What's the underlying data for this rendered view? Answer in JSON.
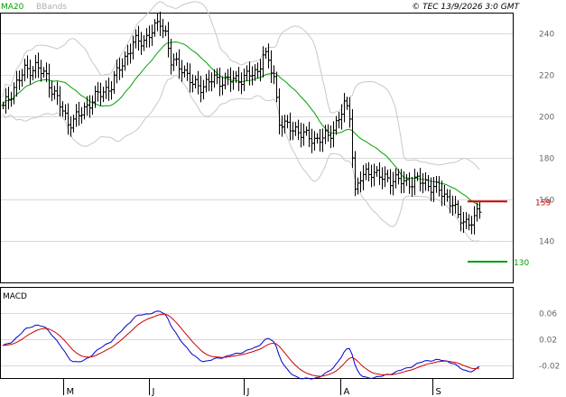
{
  "header": {
    "ma_label": "MA20",
    "bb_label": "BBands",
    "copyright": "© TEC 13/9/2026 3:0 GMT"
  },
  "colors": {
    "ma20": "#00a000",
    "bbands": "#c8c8c8",
    "price": "#000000",
    "macd": "#0000cc",
    "signal": "#cc0000",
    "resistance": "#cc0000",
    "support": "#00a000",
    "grid": "#d8d8d8"
  },
  "chart_data": [
    {
      "type": "ohlc",
      "name": "price",
      "ylim": [
        120,
        250
      ],
      "yticks": [
        140,
        160,
        180,
        200,
        220,
        240
      ],
      "xlabels": [
        "M",
        "J",
        "J",
        "A",
        "S"
      ],
      "levels": [
        {
          "value": 159,
          "label": "159",
          "color": "#cc0000"
        },
        {
          "value": 130,
          "label": "130",
          "color": "#00a000"
        }
      ],
      "anchors": [
        [
          0,
          204
        ],
        [
          4,
          214
        ],
        [
          8,
          222
        ],
        [
          12,
          224
        ],
        [
          16,
          219
        ],
        [
          20,
          208
        ],
        [
          24,
          197
        ],
        [
          28,
          200
        ],
        [
          32,
          207
        ],
        [
          36,
          211
        ],
        [
          40,
          215
        ],
        [
          44,
          226
        ],
        [
          48,
          235
        ],
        [
          52,
          237
        ],
        [
          56,
          242
        ],
        [
          58,
          246
        ],
        [
          60,
          240
        ],
        [
          62,
          226
        ],
        [
          66,
          224
        ],
        [
          70,
          215
        ],
        [
          74,
          215
        ],
        [
          78,
          218
        ],
        [
          82,
          217
        ],
        [
          86,
          218
        ],
        [
          90,
          219
        ],
        [
          94,
          222
        ],
        [
          96,
          230
        ],
        [
          98,
          226
        ],
        [
          100,
          219
        ],
        [
          102,
          198
        ],
        [
          104,
          195
        ],
        [
          108,
          194
        ],
        [
          112,
          190
        ],
        [
          116,
          189
        ],
        [
          120,
          190
        ],
        [
          124,
          199
        ],
        [
          126,
          205
        ],
        [
          128,
          201
        ],
        [
          130,
          164
        ],
        [
          132,
          170
        ],
        [
          136,
          174
        ],
        [
          140,
          170
        ],
        [
          144,
          170
        ],
        [
          148,
          168
        ],
        [
          152,
          169
        ],
        [
          156,
          168
        ],
        [
          160,
          165
        ],
        [
          164,
          161
        ],
        [
          166,
          158
        ],
        [
          168,
          151
        ],
        [
          172,
          149
        ],
        [
          174,
          150
        ],
        [
          176,
          155
        ]
      ],
      "candles": 177
    },
    {
      "type": "line",
      "name": "MACD",
      "ylim": [
        -0.04,
        0.1
      ],
      "ytick_labels": [
        "0.06",
        "0.02",
        "-0.02"
      ],
      "yticks": [
        0.06,
        0.02,
        -0.02
      ]
    }
  ]
}
